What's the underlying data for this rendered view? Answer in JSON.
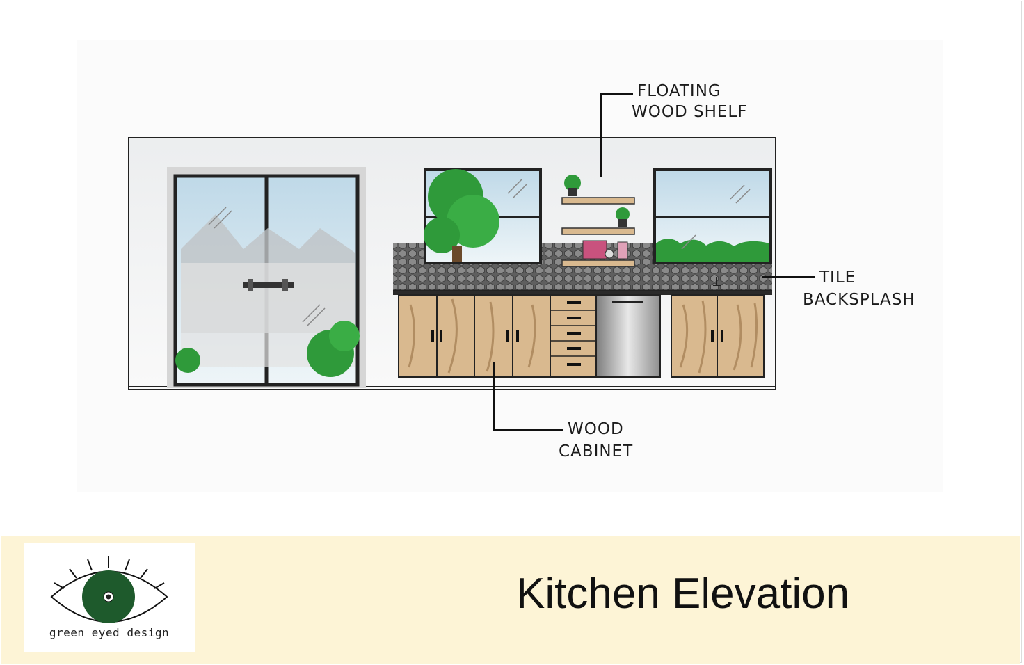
{
  "drawing": {
    "labels": {
      "shelf_line1": "FLOATING",
      "shelf_line2": "WOOD SHELF",
      "tile_line1": "TILE",
      "tile_line2": "BACKSPLASH",
      "cabinet_line1": "WOOD",
      "cabinet_line2": "CABINET"
    },
    "colors": {
      "wall_line": "#222222",
      "sky": "#cfe3ee",
      "foliage": "#2f9a3a",
      "wood": "#d9b98f",
      "tile": "#6b6b6b",
      "steel": "#9c9c9c"
    }
  },
  "footer": {
    "logo": {
      "text": "green eyed design",
      "iris_color": "#1e5a2c"
    },
    "title": "Kitchen Elevation",
    "background": "#fdf4d6"
  }
}
